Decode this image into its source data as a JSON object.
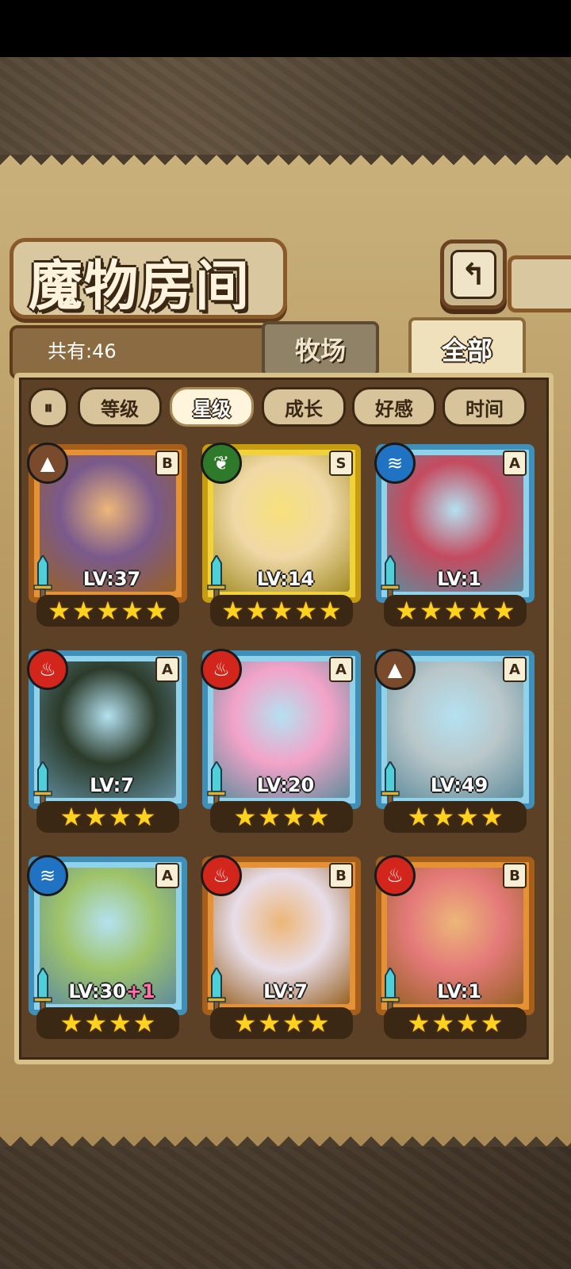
{
  "title": "魔物房间",
  "back_icon": "return-arrow-icon",
  "count_label": "共有:46",
  "tabs": [
    {
      "label": "牧场",
      "active": false
    },
    {
      "label": "全部",
      "active": true
    }
  ],
  "filter_toggle_icon": "sort-toggle-icon",
  "filters": [
    {
      "label": "等级",
      "active": false
    },
    {
      "label": "星级",
      "active": true
    },
    {
      "label": "成长",
      "active": false
    },
    {
      "label": "好感",
      "active": false
    },
    {
      "label": "时间",
      "active": false
    }
  ],
  "cards": [
    {
      "rank": "B",
      "element": "earth",
      "element_glyph": "▲",
      "frame": "bronze",
      "lv": "LV:37",
      "plus": "",
      "stars": 5,
      "portrait": "#7a5a8c"
    },
    {
      "rank": "S",
      "element": "grass",
      "element_glyph": "❦",
      "frame": "gold",
      "lv": "LV:14",
      "plus": "",
      "stars": 5,
      "portrait": "#f0d9a6"
    },
    {
      "rank": "A",
      "element": "water",
      "element_glyph": "≋",
      "frame": "blue",
      "lv": "LV:1",
      "plus": "",
      "stars": 5,
      "portrait": "#c44b60"
    },
    {
      "rank": "A",
      "element": "fire",
      "element_glyph": "♨",
      "frame": "blue",
      "lv": "LV:7",
      "plus": "",
      "stars": 4,
      "portrait": "#2c3b2a"
    },
    {
      "rank": "A",
      "element": "fire",
      "element_glyph": "♨",
      "frame": "blue",
      "lv": "LV:20",
      "plus": "",
      "stars": 4,
      "portrait": "#f3a3c8"
    },
    {
      "rank": "A",
      "element": "earth",
      "element_glyph": "▲",
      "frame": "blue",
      "lv": "LV:49",
      "plus": "",
      "stars": 4,
      "portrait": "#b9c7c9"
    },
    {
      "rank": "A",
      "element": "water",
      "element_glyph": "≋",
      "frame": "blue",
      "lv": "LV:30",
      "plus": "+1",
      "stars": 4,
      "portrait": "#9fc46a"
    },
    {
      "rank": "B",
      "element": "fire",
      "element_glyph": "♨",
      "frame": "bronze",
      "lv": "LV:7",
      "plus": "",
      "stars": 4,
      "portrait": "#e8dde8"
    },
    {
      "rank": "B",
      "element": "fire",
      "element_glyph": "♨",
      "frame": "bronze",
      "lv": "LV:1",
      "plus": "",
      "stars": 4,
      "portrait": "#e47a7a"
    }
  ]
}
